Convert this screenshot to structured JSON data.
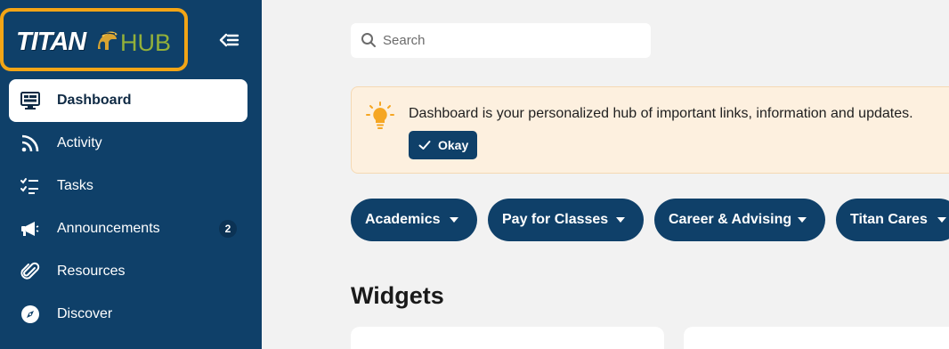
{
  "sidebar": {
    "logo": {
      "titan": "TITAN",
      "hub": "HUB"
    },
    "collapse_icon": "collapse-left-icon",
    "items": [
      {
        "label": "Dashboard",
        "icon": "dashboard-icon",
        "active": true
      },
      {
        "label": "Activity",
        "icon": "rss-icon"
      },
      {
        "label": "Tasks",
        "icon": "tasks-icon"
      },
      {
        "label": "Announcements",
        "icon": "megaphone-icon",
        "badge": "2"
      },
      {
        "label": "Resources",
        "icon": "paperclip-icon"
      },
      {
        "label": "Discover",
        "icon": "compass-icon"
      }
    ]
  },
  "search": {
    "placeholder": "Search",
    "value": ""
  },
  "notice": {
    "icon": "lightbulb-icon",
    "text": "Dashboard is your personalized hub of important links, information and updates.",
    "button_label": "Okay"
  },
  "categories": [
    {
      "label": "Academics"
    },
    {
      "label": "Pay for Classes"
    },
    {
      "label": "Career & Advising"
    },
    {
      "label": "Titan Cares"
    }
  ],
  "widgets": {
    "title": "Widgets"
  },
  "colors": {
    "sidebar_bg": "#0f4069",
    "logo_outline": "#f2a516",
    "hub_green": "#93b03a",
    "notice_bg": "#fdf0df",
    "lightbulb": "#f5a623"
  }
}
